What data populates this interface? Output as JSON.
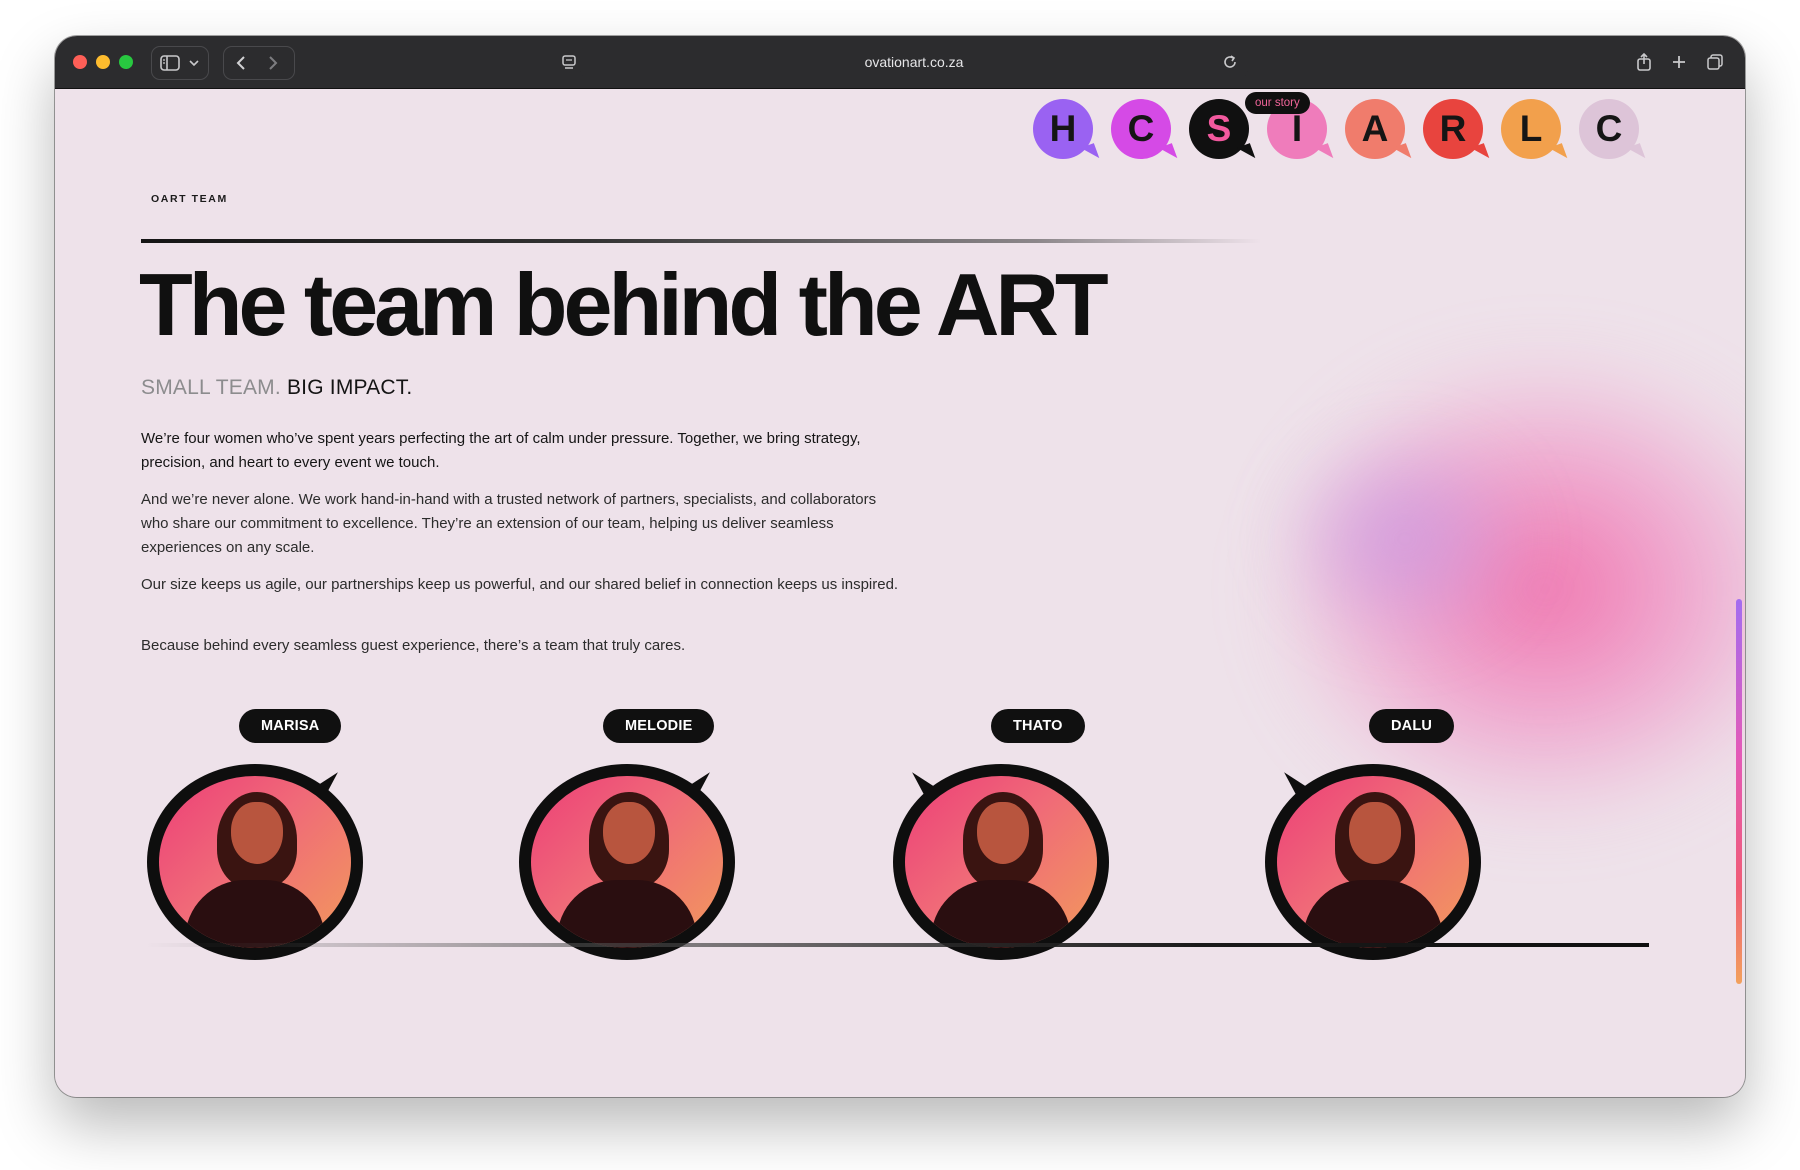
{
  "browser": {
    "url": "ovationart.co.za"
  },
  "nav": {
    "story_tag": "our story",
    "bubbles": [
      {
        "letter": "H",
        "color": "#9a62f2",
        "text_color": "#151515"
      },
      {
        "letter": "C",
        "color": "#d54ae6",
        "text_color": "#151515"
      },
      {
        "letter": "S",
        "color": "#101010",
        "text_color": "#f2599e"
      },
      {
        "letter": "I",
        "color": "#ef7cbb",
        "text_color": "#151515"
      },
      {
        "letter": "A",
        "color": "#f07c6c",
        "text_color": "#151515"
      },
      {
        "letter": "R",
        "color": "#e8443e",
        "text_color": "#151515"
      },
      {
        "letter": "L",
        "color": "#f2a04c",
        "text_color": "#151515"
      },
      {
        "letter": "C",
        "color": "#ddc4d8",
        "text_color": "#151515"
      }
    ]
  },
  "hero": {
    "eyebrow": "OART TEAM",
    "title": "The team behind the ART",
    "subtitle_light": "SMALL TEAM.",
    "subtitle_dark": "BIG IMPACT.",
    "paragraphs": [
      "We’re four women who’ve spent years perfecting the art of calm under pressure. Together, we bring strategy, precision, and heart to every event we touch.",
      "And we’re never alone. We work hand-in-hand with a trusted network of partners, specialists, and collaborators who share our commitment to excellence. They’re an extension of our team, helping us deliver seamless experiences on any scale.",
      "Our size keeps us agile, our partnerships keep us powerful, and our shared belief in connection keeps us inspired.",
      "Because behind every seamless guest experience, there’s a team that truly cares."
    ]
  },
  "team": [
    {
      "name": "MARISA"
    },
    {
      "name": "MELODIE"
    },
    {
      "name": "THATO"
    },
    {
      "name": "DALU"
    }
  ],
  "colors": {
    "page_bg": "#eee2ea",
    "accent_pink": "#f06eaa",
    "ink": "#101010"
  }
}
